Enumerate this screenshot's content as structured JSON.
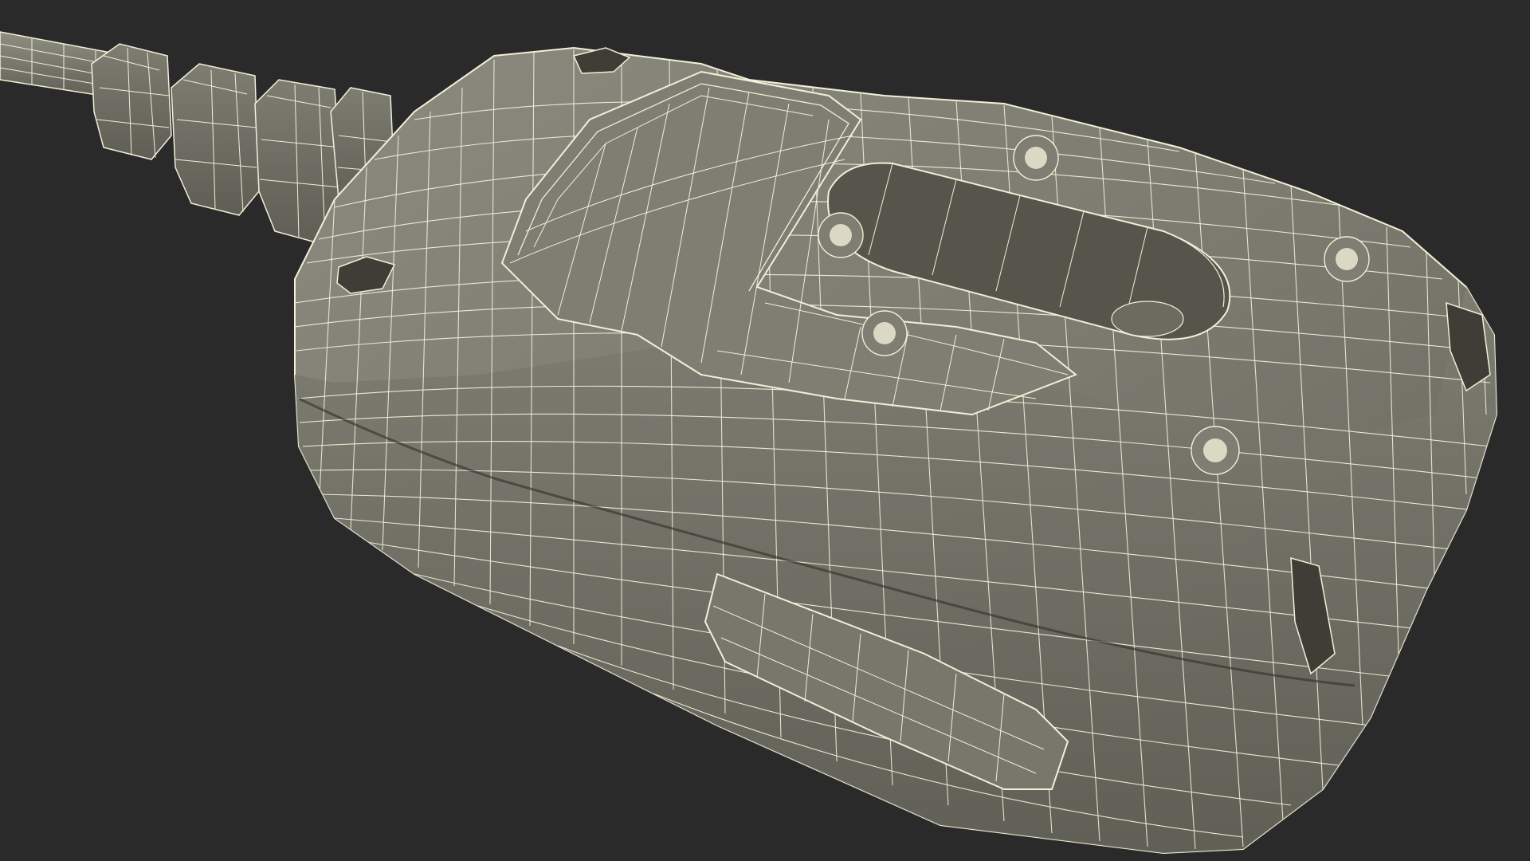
{
  "scene": {
    "subject": "wireframe-3d-model-plug-housing",
    "colors": {
      "background": "#2a2a2a",
      "surface": "#7a7a6e",
      "surface_light": "#8c8c80",
      "surface_dark": "#5c5c52",
      "wire": "#f4f1dc",
      "hole": "#3e3e37"
    }
  }
}
